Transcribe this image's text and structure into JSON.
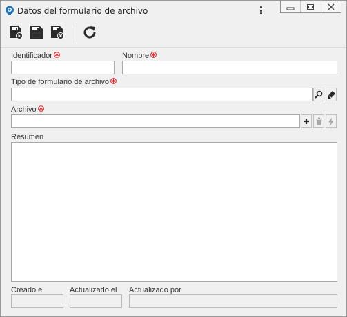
{
  "window": {
    "title": "Datos del formulario de archivo"
  },
  "toolbar": {
    "buttons": [
      {
        "name": "save-new-button",
        "icon": "save-plus-icon"
      },
      {
        "name": "save-button",
        "icon": "save-icon"
      },
      {
        "name": "save-close-button",
        "icon": "save-close-icon"
      },
      {
        "name": "refresh-button",
        "icon": "refresh-icon"
      }
    ]
  },
  "form": {
    "identificador": {
      "label": "Identificador",
      "required": true,
      "value": ""
    },
    "nombre": {
      "label": "Nombre",
      "required": true,
      "value": ""
    },
    "tipo": {
      "label": "Tipo de formulario de archivo",
      "required": true,
      "value": ""
    },
    "archivo": {
      "label": "Archivo",
      "required": true,
      "value": ""
    },
    "resumen": {
      "label": "Resumen",
      "value": ""
    },
    "creado": {
      "label": "Creado el",
      "value": ""
    },
    "actualizado": {
      "label": "Actualizado el",
      "value": ""
    },
    "actualizado_por": {
      "label": "Actualizado por",
      "value": ""
    }
  },
  "colors": {
    "required_marker": "#d9262b",
    "accent": "#1f6fb5"
  }
}
